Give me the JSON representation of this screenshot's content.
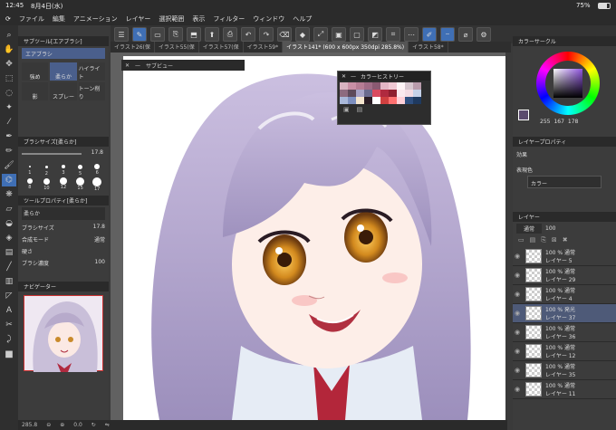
{
  "status": {
    "time": "12:45",
    "date": "8月4日(水)",
    "battery": "75%"
  },
  "menu": [
    "ファイル",
    "編集",
    "アニメーション",
    "レイヤー",
    "選択範囲",
    "表示",
    "フィルター",
    "ウィンドウ",
    "ヘルプ"
  ],
  "tabs": [
    "イラスト26(保",
    "イラスト55(保",
    "イラスト57(保",
    "イラスト59*",
    "イラスト141* (600 x 600px 350dpi 285.8%)",
    "イラスト58*"
  ],
  "subtool": {
    "header": "サブツール[エアブラシ]",
    "name": "エアブラシ",
    "options": [
      "強め",
      "柔らか",
      "ハイライト",
      "影",
      "スプレー",
      "トーン削り"
    ]
  },
  "brushsize": {
    "header": "ブラシサイズ[柔らか]",
    "value": "17.8",
    "sizes": [
      "1",
      "2",
      "3",
      "5",
      "6",
      "8",
      "10",
      "12",
      "15",
      "17"
    ]
  },
  "toolprop": {
    "header": "ツールプロパティ[柔らか]",
    "name": "柔らか",
    "brush_size_label": "ブラシサイズ",
    "brush_size": "17.8",
    "blend_label": "合成モード",
    "blend_value": "通常",
    "hardness_label": "硬さ",
    "density_label": "ブラシ濃度",
    "density": "100"
  },
  "navigator": {
    "header": "ナビゲーター",
    "zoom": "285.8",
    "angle": "0.0"
  },
  "subview": {
    "title": "サブビュー"
  },
  "colorhistory": {
    "title": "カラーヒストリー",
    "colors": [
      "#d9b3c1",
      "#c98fa5",
      "#b67d94",
      "#a06c86",
      "#8a5a72",
      "#e2b6c5",
      "#f0c9d4",
      "#fff5f7",
      "#d7c7cf",
      "#b99cac",
      "#8d6b7f",
      "#5e4a5a",
      "#a8a3c7",
      "#6b6b8f",
      "#d94b5f",
      "#b02a3f",
      "#8f1f2f",
      "#fbe9ee",
      "#f4dbe3",
      "#c5d1e8",
      "#a9b8d9",
      "#7d8fbf",
      "#f5e6cf",
      "#2a1c24",
      "#ffffff",
      "#d04040",
      "#ff7070",
      "#ffd0d8",
      "#305080",
      "#1f3a60"
    ]
  },
  "colorcircle": {
    "header": "カラーサークル",
    "h": "255",
    "s": "167",
    "v": "178",
    "accent": "#5b4a6e"
  },
  "layerprop": {
    "header": "レイヤープロパティ",
    "effect_label": "効果",
    "color_label": "表現色",
    "color_value": "カラー"
  },
  "layers": {
    "header": "レイヤー",
    "blend": "通常",
    "opacity": "100",
    "items": [
      {
        "mode": "100 % 通常",
        "name": "レイヤー 5"
      },
      {
        "mode": "100 % 通常",
        "name": "レイヤー 29"
      },
      {
        "mode": "100 % 通常",
        "name": "レイヤー 4"
      },
      {
        "mode": "100 % 発光",
        "name": "レイヤー 37"
      },
      {
        "mode": "100 % 通常",
        "name": "レイヤー 36"
      },
      {
        "mode": "100 % 通常",
        "name": "レイヤー 12"
      },
      {
        "mode": "100 % 通常",
        "name": "レイヤー 35"
      },
      {
        "mode": "100 % 通常",
        "name": "レイヤー 11"
      }
    ]
  },
  "bottom": {
    "zoom": "285.8",
    "angle": "0.0"
  }
}
